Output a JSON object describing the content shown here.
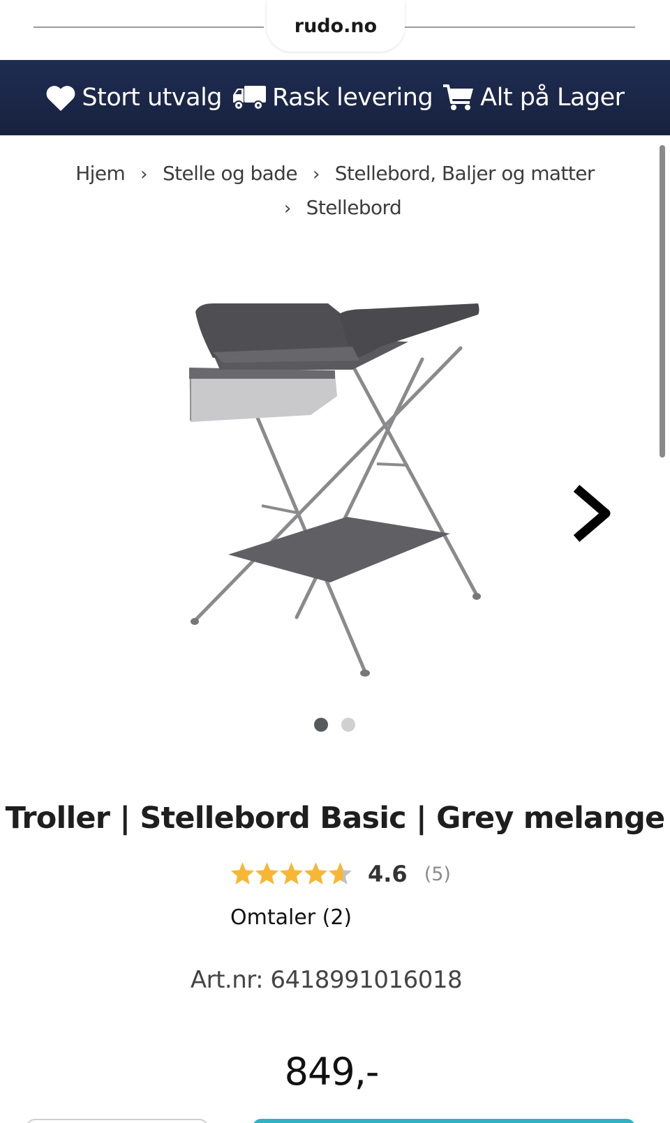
{
  "browser": {
    "url": "rudo.no"
  },
  "promo_bar": {
    "items": [
      {
        "icon": "heart-icon",
        "label": "Stort utvalg"
      },
      {
        "icon": "truck-icon",
        "label": "Rask levering"
      },
      {
        "icon": "cart-icon",
        "label": "Alt på Lager"
      }
    ]
  },
  "breadcrumb": [
    "Hjem",
    "Stelle og bade",
    "Stellebord, Baljer og matter",
    "Stellebord"
  ],
  "gallery": {
    "image_count": 2,
    "active_index": 0
  },
  "product": {
    "title": "Troller | Stellebord Basic | Grey melange",
    "rating": 4.6,
    "rating_display": "4.6",
    "rating_count": "(5)",
    "reviews_link": "Omtaler (2)",
    "article_number": "Art.nr: 6418991016018",
    "price": "849,-"
  },
  "colors": {
    "banner": "#1f2c52",
    "star": "#f7b733",
    "buy_button": "#2fb3c4"
  }
}
